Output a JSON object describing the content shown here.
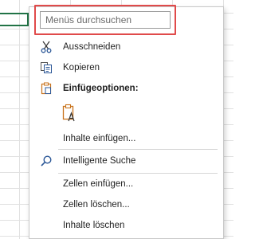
{
  "search": {
    "placeholder": "Menüs durchsuchen"
  },
  "menu": {
    "cut_label": "Ausschneiden",
    "copy_label": "Kopieren",
    "paste_options_label": "Einfügeoptionen:",
    "paste_special_label": "Inhalte einfügen...",
    "smart_lookup_label": "Intelligente Suche",
    "insert_cells_label": "Zellen einfügen...",
    "delete_cells_label": "Zellen löschen...",
    "clear_contents_label": "Inhalte löschen"
  },
  "colors": {
    "highlight_border": "#e04a4a",
    "active_cell": "#217346",
    "icon_blue": "#2b5797",
    "icon_orange": "#c8721b"
  },
  "icons": {
    "cut": "scissors-icon",
    "copy": "copy-icon",
    "paste_options": "clipboard-icon",
    "paste_text": "paste-text-icon",
    "smart_lookup": "search-icon"
  }
}
